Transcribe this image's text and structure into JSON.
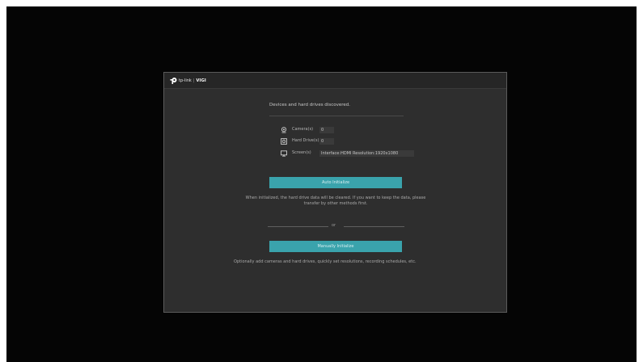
{
  "brand": {
    "company": "tp-link",
    "product": "VIGI",
    "accent_color": "#3aa3ac"
  },
  "dialog": {
    "heading": "Devices and hard drives discovered.",
    "devices": [
      {
        "icon": "camera-icon",
        "label": "Camera(s)",
        "value": "0"
      },
      {
        "icon": "hard-drive-icon",
        "label": "Hard Drive(s)",
        "value": "0"
      },
      {
        "icon": "monitor-icon",
        "label": "Screen(s)",
        "value": "Interface:HDMI Resolution:1920x1080"
      }
    ],
    "auto_button_label": "Auto Initialize",
    "auto_hint": "When initialized, the hard drive data will be cleared. If you want to keep the data, please transfer by other methods first.",
    "separator_text": "or",
    "manual_button_label": "Manually Initialize",
    "manual_hint": "Optionally add cameras and hard drives, quickly set resolutions, recording schedules, etc."
  }
}
